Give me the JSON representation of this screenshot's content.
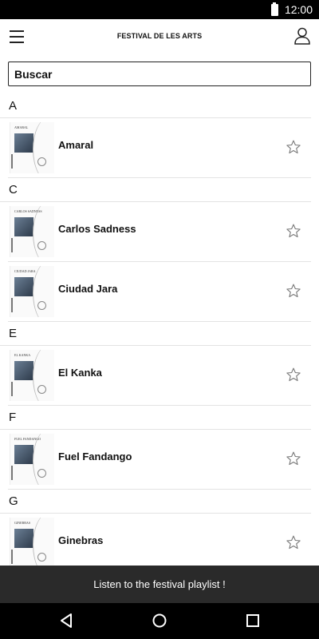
{
  "status": {
    "time": "12:00"
  },
  "header": {
    "title": "FESTIVAL DE LES ARTS"
  },
  "search": {
    "placeholder": "Buscar"
  },
  "sections": [
    {
      "letter": "A",
      "artists": [
        {
          "name": "Amaral",
          "thumb_caption": "AMARAL"
        }
      ]
    },
    {
      "letter": "C",
      "artists": [
        {
          "name": "Carlos Sadness",
          "thumb_caption": "CARLOS SADNESS"
        },
        {
          "name": "Ciudad Jara",
          "thumb_caption": "CIUDAD JARA"
        }
      ]
    },
    {
      "letter": "E",
      "artists": [
        {
          "name": "El Kanka",
          "thumb_caption": "EL KANKA"
        }
      ]
    },
    {
      "letter": "F",
      "artists": [
        {
          "name": "Fuel Fandango",
          "thumb_caption": "FUEL FANDANGO"
        }
      ]
    },
    {
      "letter": "G",
      "artists": [
        {
          "name": "Ginebras",
          "thumb_caption": "GINEBRAS"
        }
      ]
    }
  ],
  "banner": {
    "text": "Listen to the festival playlist !"
  },
  "icons": {
    "menu": "hamburger-menu-icon",
    "profile": "user-profile-icon",
    "favorite": "star-outline-icon",
    "nav_back": "triangle-back-icon",
    "nav_home": "circle-home-icon",
    "nav_recent": "square-recents-icon"
  },
  "colors": {
    "background": "#ffffff",
    "banner": "#2a2a2a",
    "status_bar": "#000000",
    "divider": "#e3e3e3"
  }
}
